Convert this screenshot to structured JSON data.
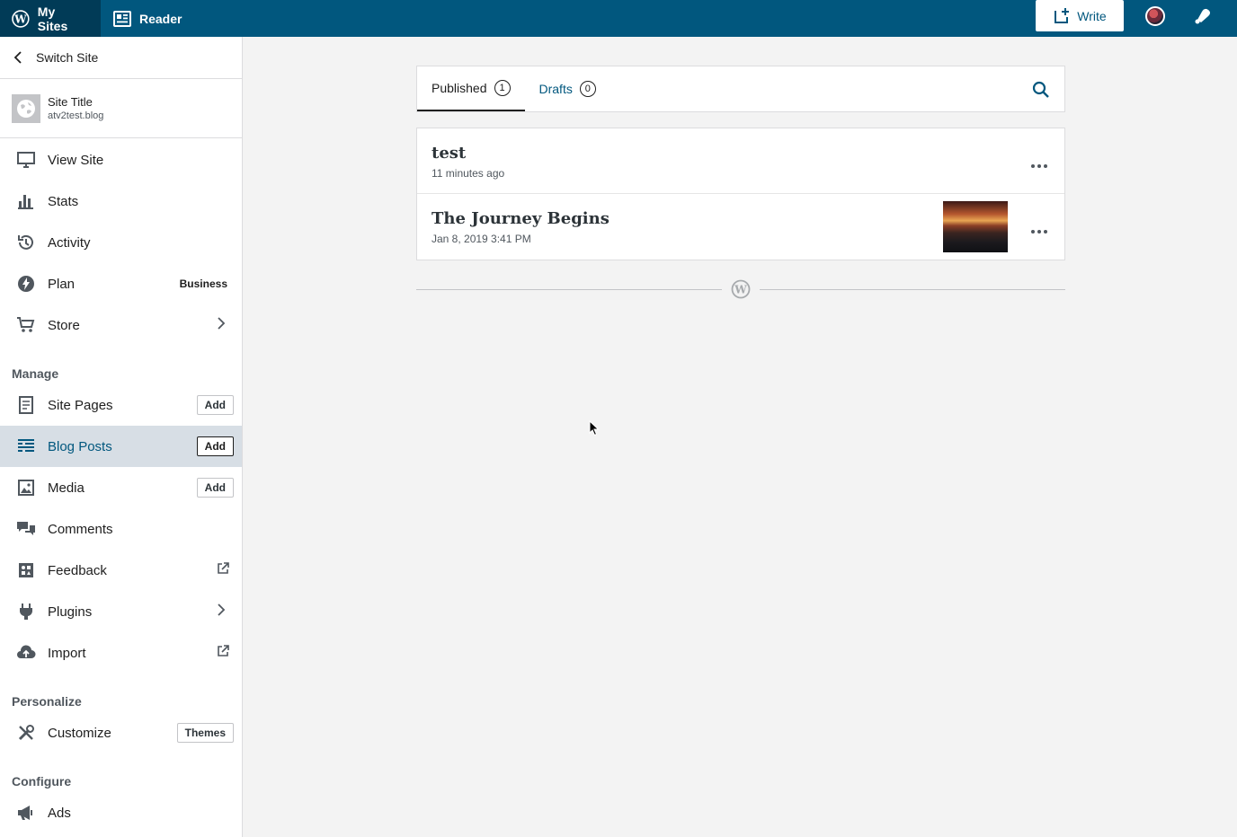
{
  "masterbar": {
    "my_sites_label": "My Sites",
    "reader_label": "Reader",
    "write_label": "Write"
  },
  "sidebar": {
    "switch_site_label": "Switch Site",
    "site": {
      "title": "Site Title",
      "url": "atv2test.blog"
    },
    "items_top": [
      {
        "label": "View Site",
        "icon": "monitor-icon"
      },
      {
        "label": "Stats",
        "icon": "bar-chart-icon"
      },
      {
        "label": "Activity",
        "icon": "history-icon"
      },
      {
        "label": "Plan",
        "icon": "plan-bolt-icon",
        "badge": "Business"
      },
      {
        "label": "Store",
        "icon": "cart-icon"
      }
    ],
    "manage_heading": "Manage",
    "manage_items": [
      {
        "label": "Site Pages",
        "icon": "page-icon",
        "button": "Add"
      },
      {
        "label": "Blog Posts",
        "icon": "posts-icon",
        "button": "Add",
        "selected": true
      },
      {
        "label": "Media",
        "icon": "image-icon",
        "button": "Add"
      },
      {
        "label": "Comments",
        "icon": "comments-icon"
      },
      {
        "label": "Feedback",
        "icon": "feedback-icon"
      },
      {
        "label": "Plugins",
        "icon": "plugin-icon"
      },
      {
        "label": "Import",
        "icon": "cloud-upload-icon"
      }
    ],
    "personalize_heading": "Personalize",
    "customize": {
      "label": "Customize",
      "button": "Themes"
    },
    "configure_heading": "Configure",
    "ads": {
      "label": "Ads"
    }
  },
  "tabs": [
    {
      "label": "Published",
      "count": "1",
      "active": true
    },
    {
      "label": "Drafts",
      "count": "0",
      "active": false
    }
  ],
  "posts": [
    {
      "title": "test",
      "meta": "11 minutes ago",
      "has_thumbnail": false
    },
    {
      "title": "The Journey Begins",
      "meta": "Jan 8, 2019 3:41 PM",
      "has_thumbnail": true
    }
  ],
  "colors": {
    "masterbar": "#01577e",
    "masterbar_active": "#013b57",
    "selected_bg": "#d7dee5",
    "link": "#01577e"
  }
}
